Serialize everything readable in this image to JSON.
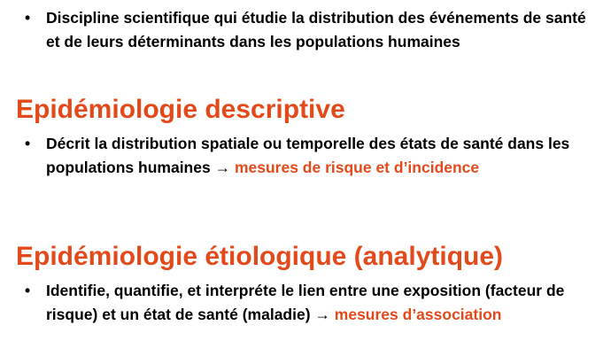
{
  "slide": {
    "intro_bullet": {
      "marker": "•",
      "text": "Discipline scientifique qui étudie la distribution des événements de santé et de leurs déterminants dans les populations humaines"
    },
    "sections": [
      {
        "heading": "Epidémiologie descriptive",
        "bullet_marker": "•",
        "bullet_text": "Décrit la distribution spatiale ou temporelle des états de santé dans les populations humaines → ",
        "bullet_highlight": "mesures de risque et d’incidence"
      },
      {
        "heading": "Epidémiologie étiologique (analytique)",
        "bullet_marker": "•",
        "bullet_text": "Identifie, quantifie, et interpréte le lien entre une exposition (facteur de risque) et un état de santé (maladie) → ",
        "bullet_highlight": "mesures d’association"
      }
    ],
    "colors": {
      "accent": "#E24A1B",
      "text": "#000000",
      "background": "#FFFFFF"
    }
  }
}
